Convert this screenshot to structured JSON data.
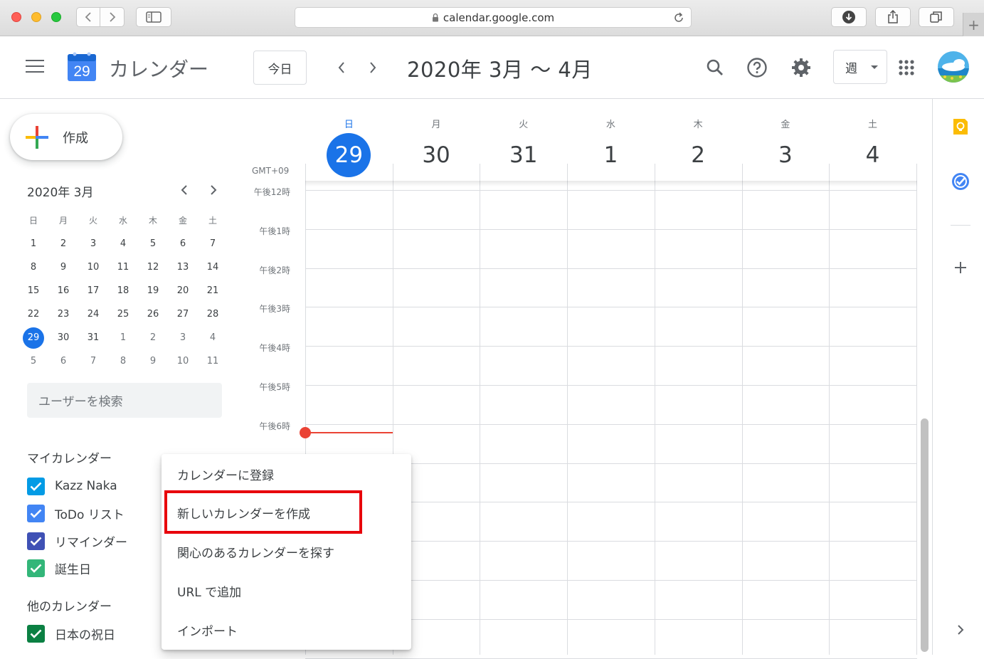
{
  "browser": {
    "url": "calendar.google.com"
  },
  "header": {
    "app_name": "カレンダー",
    "logo_day": "29",
    "today_label": "今日",
    "date_range": "2020年 3月 〜 4月",
    "view_label": "週"
  },
  "sidebar": {
    "create_label": "作成",
    "mini_calendar": {
      "title": "2020年 3月",
      "weekdays": [
        "日",
        "月",
        "火",
        "水",
        "木",
        "金",
        "土"
      ],
      "weeks": [
        [
          "1",
          "2",
          "3",
          "4",
          "5",
          "6",
          "7"
        ],
        [
          "8",
          "9",
          "10",
          "11",
          "12",
          "13",
          "14"
        ],
        [
          "15",
          "16",
          "17",
          "18",
          "19",
          "20",
          "21"
        ],
        [
          "22",
          "23",
          "24",
          "25",
          "26",
          "27",
          "28"
        ],
        [
          "29",
          "30",
          "31",
          "1",
          "2",
          "3",
          "4"
        ],
        [
          "5",
          "6",
          "7",
          "8",
          "9",
          "10",
          "11"
        ]
      ],
      "selected": "29"
    },
    "search_placeholder": "ユーザーを検索",
    "my_calendars_title": "マイカレンダー",
    "my_calendars": [
      {
        "label": "Kazz Naka",
        "color": "#039be5"
      },
      {
        "label": "ToDo リスト",
        "color": "#4285f4"
      },
      {
        "label": "リマインダー",
        "color": "#3f51b5"
      },
      {
        "label": "誕生日",
        "color": "#33b679"
      }
    ],
    "other_calendars_title": "他のカレンダー",
    "other_calendars": [
      {
        "label": "日本の祝日",
        "color": "#0b8043"
      }
    ]
  },
  "week": {
    "days": [
      {
        "dow": "日",
        "num": "29",
        "today": true
      },
      {
        "dow": "月",
        "num": "30"
      },
      {
        "dow": "火",
        "num": "31"
      },
      {
        "dow": "水",
        "num": "1"
      },
      {
        "dow": "木",
        "num": "2"
      },
      {
        "dow": "金",
        "num": "3"
      },
      {
        "dow": "土",
        "num": "4"
      }
    ],
    "timezone": "GMT+09",
    "hours": [
      "午後12時",
      "午後1時",
      "午後2時",
      "午後3時",
      "午後4時",
      "午後5時",
      "午後6時"
    ]
  },
  "context_menu": {
    "items": [
      "カレンダーに登録",
      "新しいカレンダーを作成",
      "関心のあるカレンダーを探す",
      "URL で追加",
      "インポート"
    ],
    "highlighted": "新しいカレンダーを作成"
  },
  "colors": {
    "accent": "#1a73e8",
    "now_line": "#ea4335",
    "highlight": "#e8000b"
  }
}
